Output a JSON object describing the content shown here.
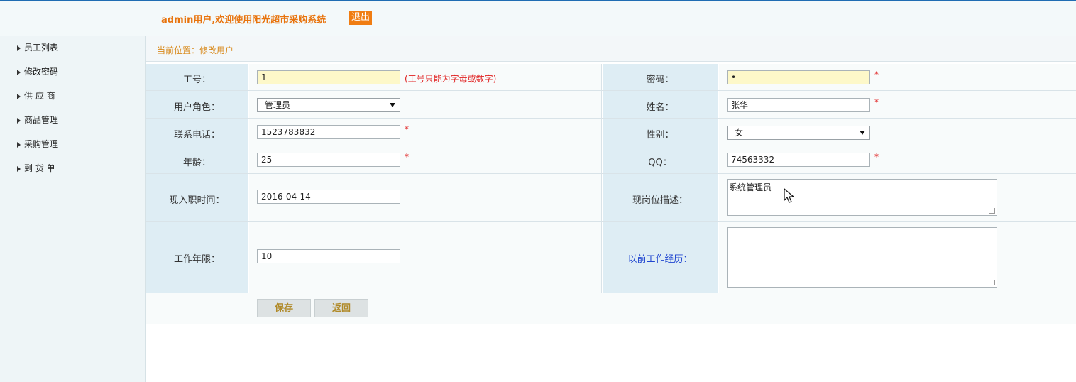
{
  "header": {
    "welcome": "admin用户,欢迎使用阳光超市采购系统",
    "logout": "退出"
  },
  "sidebar": {
    "items": [
      {
        "label": "员工列表"
      },
      {
        "label": "修改密码"
      },
      {
        "label": "供 应 商"
      },
      {
        "label": "商品管理"
      },
      {
        "label": "采购管理"
      },
      {
        "label": "到 货 单"
      }
    ]
  },
  "breadcrumb": "当前位置：修改用户",
  "form": {
    "emp_no_label": "工号：",
    "emp_no_value": "1",
    "emp_no_hint": "(工号只能为字母或数字)",
    "password_label": "密码：",
    "password_value": "•",
    "role_label": "用户角色：",
    "role_value": "管理员",
    "name_label": "姓名：",
    "name_value": "张华",
    "phone_label": "联系电话：",
    "phone_value": "1523783832",
    "gender_label": "性别：",
    "gender_value": "女",
    "age_label": "年龄：",
    "age_value": "25",
    "qq_label": "QQ：",
    "qq_value": "74563332",
    "hire_date_label": "现入职时间：",
    "hire_date_value": "2016-04-14",
    "position_desc_label": "现岗位描述：",
    "position_desc_value": "系统管理员",
    "work_years_label": "工作年限：",
    "work_years_value": "10",
    "prev_experience_label": "以前工作经历：",
    "prev_experience_value": "",
    "required_mark": "*",
    "save_label": "保存",
    "back_label": "返回"
  }
}
